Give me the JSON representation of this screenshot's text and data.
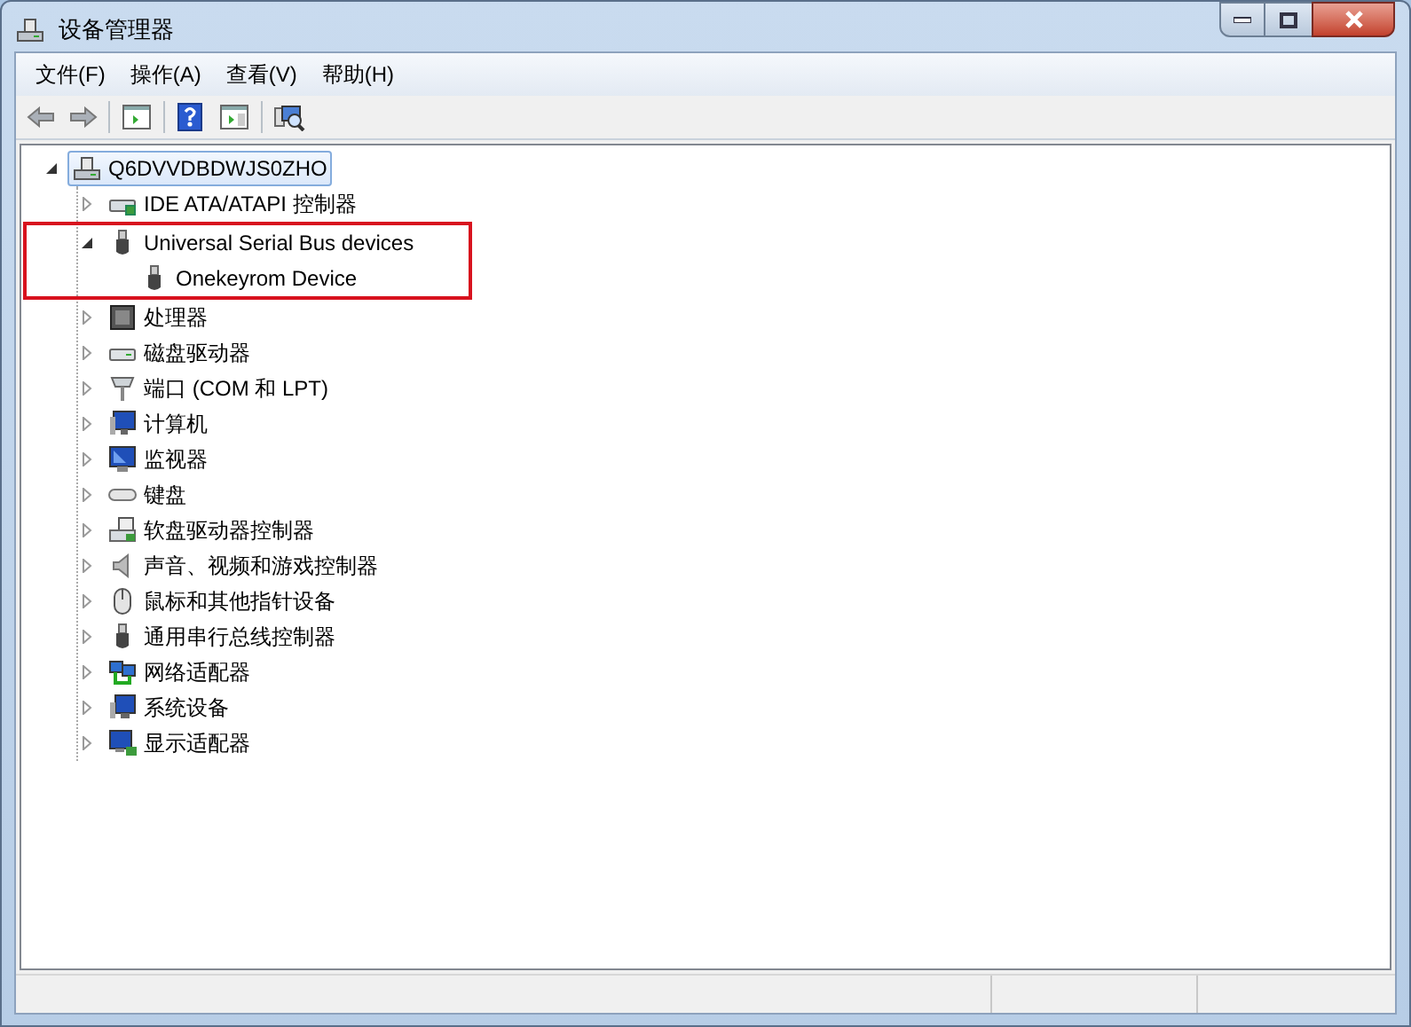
{
  "window": {
    "title": "设备管理器"
  },
  "menu": [
    "文件(F)",
    "操作(A)",
    "查看(V)",
    "帮助(H)"
  ],
  "tree": {
    "label": "Q6DVVDBDWJS0ZHO",
    "selected": true,
    "expanded": true,
    "children": [
      {
        "label": "IDE ATA/ATAPI 控制器",
        "selected": false,
        "expanded": false,
        "highlighted": false
      },
      {
        "label": "Universal Serial Bus devices",
        "selected": false,
        "expanded": true,
        "highlighted": true,
        "children": [
          {
            "label": "Onekeyrom Device",
            "selected": false
          }
        ]
      },
      {
        "label": "处理器",
        "selected": false,
        "expanded": false,
        "highlighted": false
      },
      {
        "label": "磁盘驱动器",
        "selected": false,
        "expanded": false,
        "highlighted": false
      },
      {
        "label": "端口 (COM 和 LPT)",
        "selected": false,
        "expanded": false,
        "highlighted": false
      },
      {
        "label": "计算机",
        "selected": false,
        "expanded": false,
        "highlighted": false
      },
      {
        "label": "监视器",
        "selected": false,
        "expanded": false,
        "highlighted": false
      },
      {
        "label": "键盘",
        "selected": false,
        "expanded": false,
        "highlighted": false
      },
      {
        "label": "软盘驱动器控制器",
        "selected": false,
        "expanded": false,
        "highlighted": false
      },
      {
        "label": "声音、视频和游戏控制器",
        "selected": false,
        "expanded": false,
        "highlighted": false
      },
      {
        "label": "鼠标和其他指针设备",
        "selected": false,
        "expanded": false,
        "highlighted": false
      },
      {
        "label": "通用串行总线控制器",
        "selected": false,
        "expanded": false,
        "highlighted": false
      },
      {
        "label": "网络适配器",
        "selected": false,
        "expanded": false,
        "highlighted": false
      },
      {
        "label": "系统设备",
        "selected": false,
        "expanded": false,
        "highlighted": false
      },
      {
        "label": "显示适配器",
        "selected": false,
        "expanded": false,
        "highlighted": false
      }
    ]
  }
}
